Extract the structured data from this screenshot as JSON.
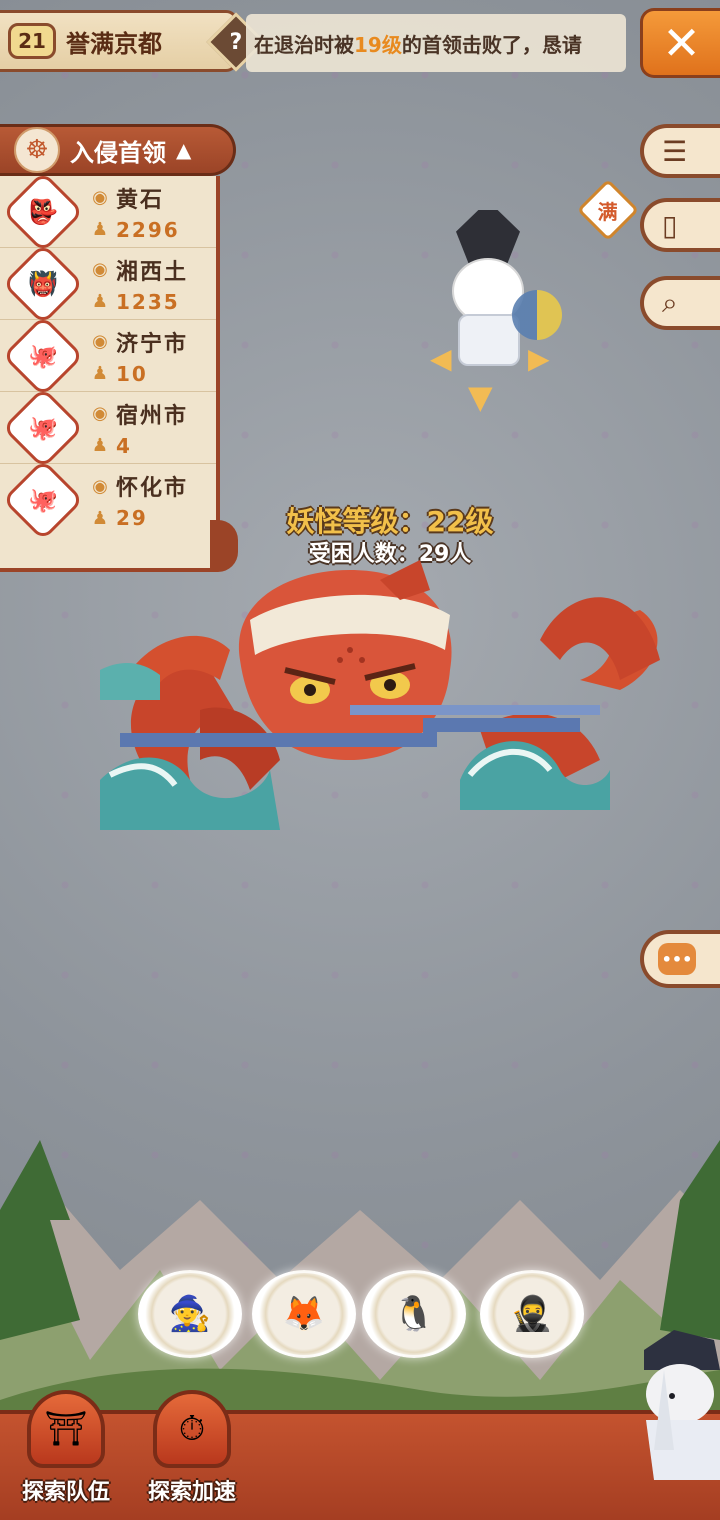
{
  "header": {
    "level": "21",
    "area_name": "誉满京都",
    "help_icon": "question-mark-icon",
    "ticker": {
      "prefix": "在退治时被",
      "highlight": "19级",
      "suffix": "的首领击败了，恳请"
    },
    "close_icon": "close-x-icon"
  },
  "invaders": {
    "title": "入侵首领",
    "header_icon": "fox-mask-icon",
    "toggle_icon": "triangle-up-icon",
    "items": [
      {
        "city": "黄石",
        "count": "2296",
        "avatar": "samurai-boss"
      },
      {
        "city": "湘西土",
        "count": "1235",
        "avatar": "demon-boss"
      },
      {
        "city": "济宁市",
        "count": "10",
        "avatar": "octopus-boss"
      },
      {
        "city": "宿州市",
        "count": "4",
        "avatar": "octopus-boss"
      },
      {
        "city": "怀化市",
        "count": "29",
        "avatar": "octopus-boss"
      }
    ]
  },
  "side_buttons": {
    "list_icon": "list-icon",
    "card_icon": "card-icon",
    "search_icon": "search-icon",
    "full_badge": "满",
    "chat_icon": "chat-icon"
  },
  "boss": {
    "level_text": "妖怪等级：22级",
    "trapped_text": "受困人数：29人"
  },
  "bottom": {
    "team_label": "探索队伍",
    "speed_label": "探索加速"
  },
  "colors": {
    "accent_orange": "#e88a1f",
    "panel_brown": "#8a4b2c",
    "bar_red": "#c4532f"
  }
}
